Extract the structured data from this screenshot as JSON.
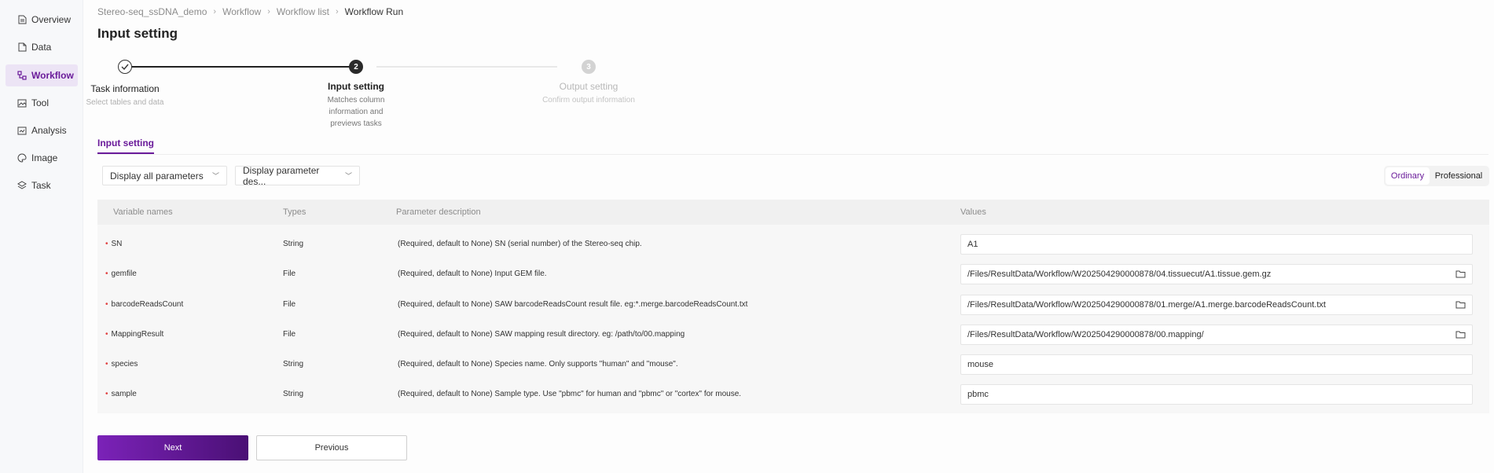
{
  "sidebar": {
    "items": [
      {
        "label": "Overview",
        "icon": "document-icon"
      },
      {
        "label": "Data",
        "icon": "file-icon"
      },
      {
        "label": "Workflow",
        "icon": "workflow-icon",
        "active": true
      },
      {
        "label": "Tool",
        "icon": "image-icon"
      },
      {
        "label": "Analysis",
        "icon": "chart-icon"
      },
      {
        "label": "Image",
        "icon": "palette-icon"
      },
      {
        "label": "Task",
        "icon": "layers-icon"
      }
    ]
  },
  "breadcrumb": [
    "Stereo-seq_ssDNA_demo",
    "Workflow",
    "Workflow list",
    "Workflow Run"
  ],
  "page_title": "Input setting",
  "steps": [
    {
      "number": "1",
      "title": "Task information",
      "subtitle": "Select tables and data",
      "state": "done"
    },
    {
      "number": "2",
      "title": "Input setting",
      "subtitle": "Matches column information and previews tasks",
      "state": "current"
    },
    {
      "number": "3",
      "title": "Output setting",
      "subtitle": "Confirm output information",
      "state": "pending"
    }
  ],
  "tab_label": "Input setting",
  "filters": {
    "display_params": "Display all parameters",
    "display_desc": "Display parameter des..."
  },
  "mode_toggle": {
    "ordinary": "Ordinary",
    "professional": "Professional",
    "selected": "Ordinary"
  },
  "table": {
    "headers": [
      "Variable names",
      "Types",
      "Parameter description",
      "Values"
    ],
    "rows": [
      {
        "name": "SN",
        "type": "String",
        "desc": "(Required, default to None) SN (serial number) of the Stereo-seq chip.",
        "value": "A1",
        "browse": false
      },
      {
        "name": "gemfile",
        "type": "File",
        "desc": "(Required, default to None) Input GEM file.",
        "value": "/Files/ResultData/Workflow/W202504290000878/04.tissuecut/A1.tissue.gem.gz",
        "browse": true
      },
      {
        "name": "barcodeReadsCount",
        "type": "File",
        "desc": "(Required, default to None) SAW barcodeReadsCount result file. eg:*.merge.barcodeReadsCount.txt",
        "value": "/Files/ResultData/Workflow/W202504290000878/01.merge/A1.merge.barcodeReadsCount.txt",
        "browse": true
      },
      {
        "name": "MappingResult",
        "type": "File",
        "desc": "(Required, default to None) SAW mapping result directory. eg: /path/to/00.mapping",
        "value": "/Files/ResultData/Workflow/W202504290000878/00.mapping/",
        "browse": true
      },
      {
        "name": "species",
        "type": "String",
        "desc": "(Required, default to None) Species name. Only supports \"human\" and \"mouse\".",
        "value": "mouse",
        "browse": false
      },
      {
        "name": "sample",
        "type": "String",
        "desc": "(Required, default to None) Sample type. Use \"pbmc\" for human and \"pbmc\" or \"cortex\" for mouse.",
        "value": "pbmc",
        "browse": false
      }
    ]
  },
  "buttons": {
    "next": "Next",
    "previous": "Previous"
  },
  "colors": {
    "accent": "#6a1b9a",
    "required": "#e04040"
  }
}
